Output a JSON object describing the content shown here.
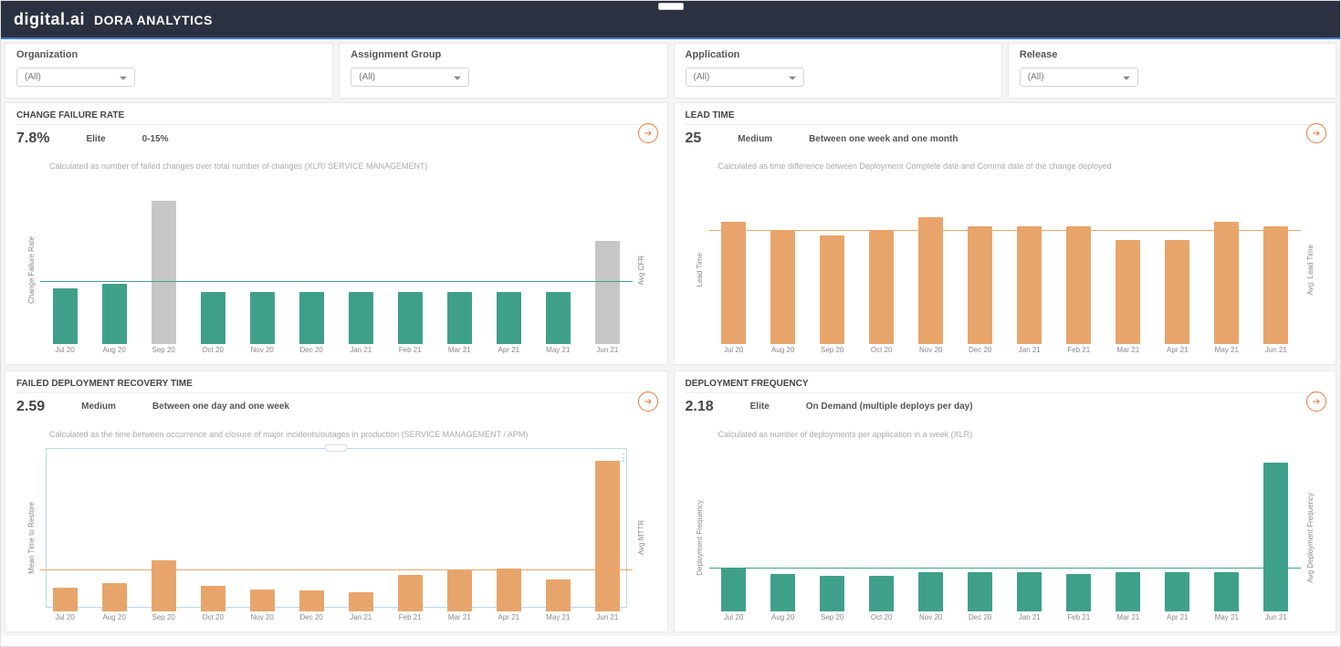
{
  "header": {
    "brand": "digital.ai",
    "subtitle": "DORA ANALYTICS"
  },
  "filters": [
    {
      "label": "Organization",
      "value": "(All)"
    },
    {
      "label": "Assignment Group",
      "value": "(All)"
    },
    {
      "label": "Application",
      "value": "(All)"
    },
    {
      "label": "Release",
      "value": "(All)"
    }
  ],
  "colors": {
    "teal": "#3fa08a",
    "orange": "#e8a56b",
    "grey": "#c6c6c6",
    "orangeLine": "#e8a56b",
    "tealLine": "#3fa08a"
  },
  "months": [
    "Jul 20",
    "Aug 20",
    "Sep 20",
    "Oct 20",
    "Nov 20",
    "Dec 20",
    "Jan 21",
    "Feb 21",
    "Mar 21",
    "Apr 21",
    "May 21",
    "Jun 21"
  ],
  "cards": [
    {
      "key": "cfr",
      "title": "CHANGE FAILURE RATE",
      "value": "7.8%",
      "tag": "Elite",
      "desc": "0-15%",
      "note": "Calculated as number of failed changes over total number of changes (XLR/ SERVICE MANAGEMENT)",
      "ylabel_left": "Change Failure Rate",
      "ylabel_right": "Avg CFR"
    },
    {
      "key": "lead",
      "title": "LEAD TIME",
      "value": "25",
      "tag": "Medium",
      "desc": "Between one week and one month",
      "note": "Calculated as time difference between Deployment Complete date and Commit date of the change deployed",
      "ylabel_left": "Lead Time",
      "ylabel_right": "Avg. Lead Time"
    },
    {
      "key": "fdrt",
      "title": "FAILED DEPLOYMENT RECOVERY TIME",
      "value": "2.59",
      "tag": "Medium",
      "desc": "Between one day and one week",
      "note": "Calculated as the time between occurrence and closure of major incidents/outages in production (SERVICE MANAGEMENT / APM)",
      "ylabel_left": "Mean Time to Restore",
      "ylabel_right": "Avg MTTR"
    },
    {
      "key": "dfreq",
      "title": "DEPLOYMENT FREQUENCY",
      "value": "2.18",
      "tag": "Elite",
      "desc": "On Demand (multiple deploys per day)",
      "note": "Calculated as number of deployments per application in a week (XLR)",
      "ylabel_left": "Deployment Frequency",
      "ylabel_right": "Avg Deployment Frequency"
    }
  ],
  "chart_data": [
    {
      "key": "cfr",
      "type": "bar",
      "ylabel": "Change Failure Rate",
      "ylim": [
        0,
        20
      ],
      "categories": [
        "Jul 20",
        "Aug 20",
        "Sep 20",
        "Oct 20",
        "Nov 20",
        "Dec 20",
        "Jan 21",
        "Feb 21",
        "Mar 21",
        "Apr 21",
        "May 21",
        "Jun 21"
      ],
      "values": [
        7,
        7.5,
        18,
        6.5,
        6.5,
        6.5,
        6.5,
        6.5,
        6.5,
        6.5,
        6.5,
        13
      ],
      "highlight_index": [
        2,
        11
      ],
      "average": 7.8,
      "avg_color": "#3fa08a",
      "bar_color": "#3fa08a",
      "highlight_color": "#c6c6c6"
    },
    {
      "key": "lead",
      "type": "bar",
      "ylabel": "Lead Time",
      "ylim": [
        0,
        35
      ],
      "categories": [
        "Jul 20",
        "Aug 20",
        "Sep 20",
        "Oct 20",
        "Nov 20",
        "Dec 20",
        "Jan 21",
        "Feb 21",
        "Mar 21",
        "Apr 21",
        "May 21",
        "Jun 21"
      ],
      "values": [
        27,
        25,
        24,
        25,
        28,
        26,
        26,
        26,
        23,
        23,
        27,
        26
      ],
      "highlight_index": [],
      "average": 25,
      "avg_color": "#e8a56b",
      "bar_color": "#e8a56b"
    },
    {
      "key": "fdrt",
      "type": "bar",
      "ylabel": "Mean Time to Restore",
      "ylim": [
        0,
        10
      ],
      "categories": [
        "Jul 20",
        "Aug 20",
        "Sep 20",
        "Oct 20",
        "Nov 20",
        "Dec 20",
        "Jan 21",
        "Feb 21",
        "Mar 21",
        "Apr 21",
        "May 21",
        "Jun 21"
      ],
      "values": [
        1.5,
        1.8,
        3.2,
        1.6,
        1.4,
        1.3,
        1.2,
        2.3,
        2.6,
        2.7,
        2.0,
        9.5
      ],
      "highlight_index": [],
      "average": 2.59,
      "avg_color": "#e8a56b",
      "bar_color": "#e8a56b",
      "boxed": true
    },
    {
      "key": "dfreq",
      "type": "bar",
      "ylabel": "Deployment Frequency",
      "ylim": [
        0,
        8
      ],
      "categories": [
        "Jul 20",
        "Aug 20",
        "Sep 20",
        "Oct 20",
        "Nov 20",
        "Dec 20",
        "Jan 21",
        "Feb 21",
        "Mar 21",
        "Apr 21",
        "May 21",
        "Jun 21"
      ],
      "values": [
        2.2,
        1.9,
        1.8,
        1.8,
        2.0,
        2.0,
        2.0,
        1.9,
        2.0,
        2.0,
        2.0,
        7.5
      ],
      "highlight_index": [],
      "average": 2.18,
      "avg_color": "#3fa08a",
      "bar_color": "#3fa08a"
    }
  ]
}
